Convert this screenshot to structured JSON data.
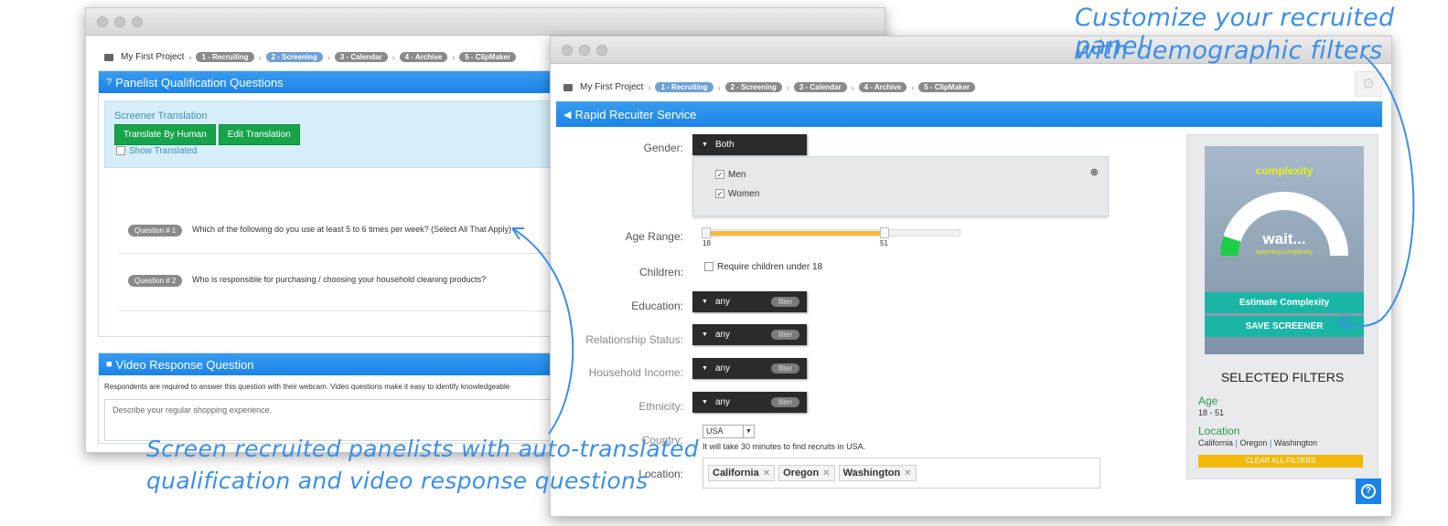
{
  "back_window": {
    "breadcrumb": {
      "project": "My First Project",
      "steps": [
        "1 - Recruiting",
        "2 - Screening",
        "3 - Calendar",
        "4 - Archive",
        "5 - ClipMaker"
      ]
    },
    "qualification": {
      "title": "Panelist Qualification Questions",
      "screener_title": "Screener Translation",
      "translate_button": "Translate By Human",
      "edit_button": "Edit Translation",
      "show_translated": "Show Translated",
      "questions": [
        {
          "badge": "Question # 1",
          "text": "Which of the following do you use at least 5 to 6 times per week? (Select All That Apply)"
        },
        {
          "badge": "Question # 2",
          "text": "Who is responsible for purchasing / choosing your household cleaning products?"
        }
      ]
    },
    "video": {
      "title": "Video Response Question",
      "description": "Respondents are required to answer this question with their webcam. Video questions make it easy to identify knowledgeable",
      "textarea_text": "Describe your regular shopping experience."
    }
  },
  "front_window": {
    "breadcrumb": {
      "project": "My First Project",
      "steps": [
        "1 - Recruiting",
        "2 - Screening",
        "3 - Calendar",
        "4 - Archive",
        "5 - ClipMaker"
      ]
    },
    "title": "Rapid Recuiter Service",
    "form": {
      "gender": {
        "label": "Gender:",
        "value": "Both",
        "options": [
          "Men",
          "Women"
        ]
      },
      "age_range": {
        "label": "Age Range:",
        "min": "18",
        "max": "51"
      },
      "children": {
        "label": "Children:",
        "option": "Require children under 18"
      },
      "education": {
        "label": "Education:",
        "value": "any",
        "filter": "filter"
      },
      "relationship": {
        "label": "Relationship Status:",
        "value": "any",
        "filter": "filter"
      },
      "income": {
        "label": "Household Income:",
        "value": "any",
        "filter": "filter"
      },
      "ethnicity": {
        "label": "Ethnicity:",
        "value": "any",
        "filter": "filter"
      },
      "country": {
        "label": "Country:",
        "value": "USA",
        "note": "It will take 30 minutes to find recruits in USA."
      },
      "location": {
        "label": "Location:",
        "tags": [
          "California",
          "Oregon",
          "Washington"
        ]
      }
    },
    "side_panel": {
      "complexity_title": "complexity",
      "gauge_main": "wait...",
      "gauge_sub": "targeting complexity",
      "gauge_level": 0.1,
      "estimate_button": "Estimate Complexity",
      "save_button": "SAVE SCREENER",
      "selected_title": "SELECTED FILTERS",
      "age_label": "Age",
      "age_value": "18 - 51",
      "location_label": "Location",
      "locations": [
        "California",
        "Oregon",
        "Washington"
      ],
      "clear_button": "CLEAR ALL FILTERS"
    },
    "help_icon": "?"
  },
  "annotations": {
    "top_right_line1": "Customize your recruited panel",
    "top_right_line2": "with demographic filters",
    "bottom_left_line1": "Screen recruited panelists with auto-translated",
    "bottom_left_line2": "qualification and video response questions"
  },
  "colors": {
    "blue_header": "#1a84e6",
    "green_button": "#17a34a",
    "teal_button": "#1bb5a6",
    "yellow_clear": "#f2b90c",
    "annotation_blue": "#3d8ee6",
    "slider_fill": "#f6b93b"
  }
}
